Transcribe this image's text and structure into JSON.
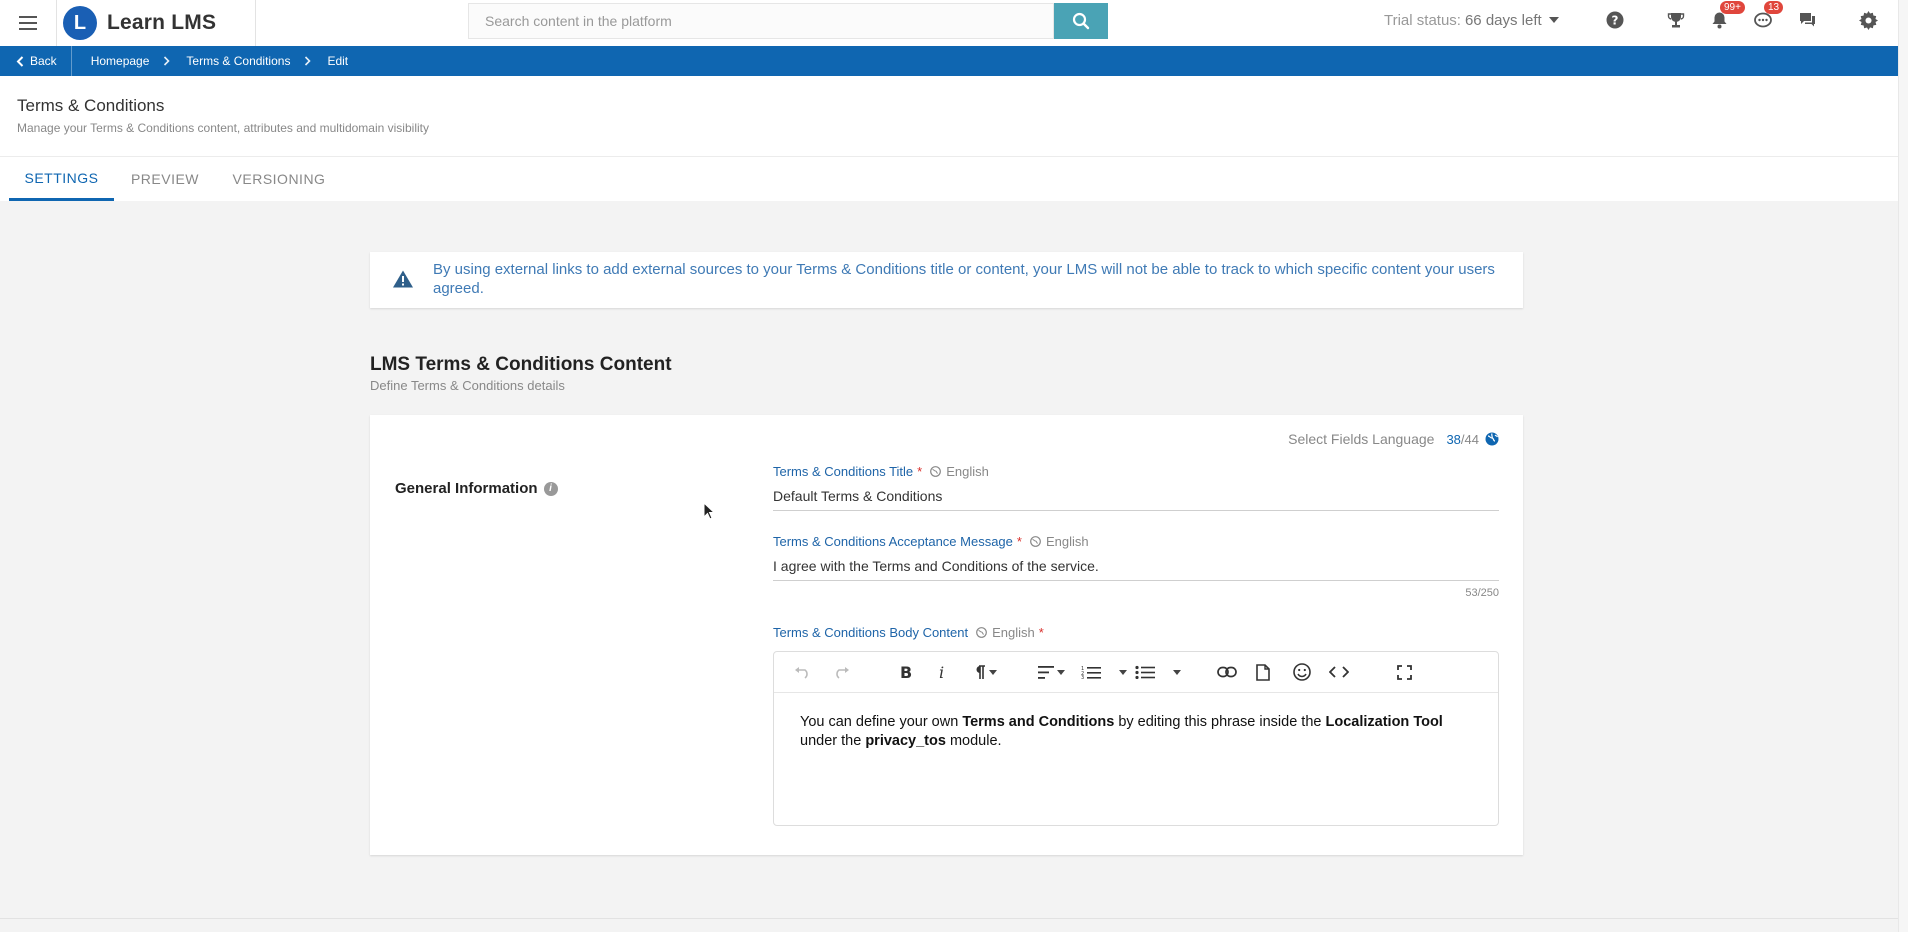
{
  "header": {
    "brand_name": "Learn LMS",
    "brand_initial": "L",
    "search": {
      "placeholder": "Search content in the platform"
    },
    "trial": {
      "label": "Trial status:",
      "days": "66 days left"
    },
    "notifications_badge": "99+",
    "messages_badge": "13",
    "icons": [
      "menu-icon",
      "search-icon",
      "help-icon",
      "trophy-icon",
      "bell-icon",
      "chat-bubble-icon",
      "comments-icon",
      "gear-icon"
    ]
  },
  "breadcrumb": {
    "back_label": "Back",
    "items": [
      "Homepage",
      "Terms & Conditions",
      "Edit"
    ]
  },
  "page": {
    "title": "Terms & Conditions",
    "subtitle": "Manage your Terms & Conditions content, attributes and multidomain visibility"
  },
  "tabs": [
    {
      "label": "SETTINGS",
      "active": true
    },
    {
      "label": "PREVIEW",
      "active": false
    },
    {
      "label": "VERSIONING",
      "active": false
    }
  ],
  "alert": {
    "text": "By using external links to add external sources to your Terms & Conditions title or content, your LMS will not be able to track to which specific content your users agreed."
  },
  "section": {
    "title": "LMS Terms & Conditions Content",
    "subtitle": "Define Terms & Conditions details"
  },
  "card": {
    "language_select_label": "Select Fields Language",
    "language_count": "38",
    "language_total": "/44",
    "group_label": "General Information",
    "fields": {
      "title": {
        "label": "Terms & Conditions Title",
        "required": "*",
        "language": "English",
        "value": "Default Terms & Conditions"
      },
      "acceptance": {
        "label": "Terms & Conditions Acceptance Message",
        "required": "*",
        "language": "English",
        "value": "I agree with the Terms and Conditions of the service.",
        "counter": "53/250"
      },
      "body": {
        "label": "Terms & Conditions Body Content",
        "required": "*",
        "language": "English"
      }
    },
    "editor": {
      "line1_a": "You can define your own ",
      "line1_b": "Terms and Conditions",
      "line1_c": " by editing this phrase inside the ",
      "line1_d": "Localization Tool",
      "line2_a": "under the ",
      "line2_b": "privacy_tos",
      "line2_c": " module.",
      "toolbar_icons": [
        "undo-icon",
        "redo-icon",
        "bold-icon",
        "italic-icon",
        "paragraph-icon",
        "align-icon",
        "ordered-list-icon",
        "unordered-list-icon",
        "link-icon",
        "file-icon",
        "emoji-icon",
        "code-icon",
        "fullscreen-icon"
      ]
    }
  },
  "colors": {
    "primary": "#0f66b1",
    "search_button": "#4aa3b5",
    "badge": "#e0463c",
    "alert_text": "#3f7ab5",
    "required": "#d9302c"
  }
}
